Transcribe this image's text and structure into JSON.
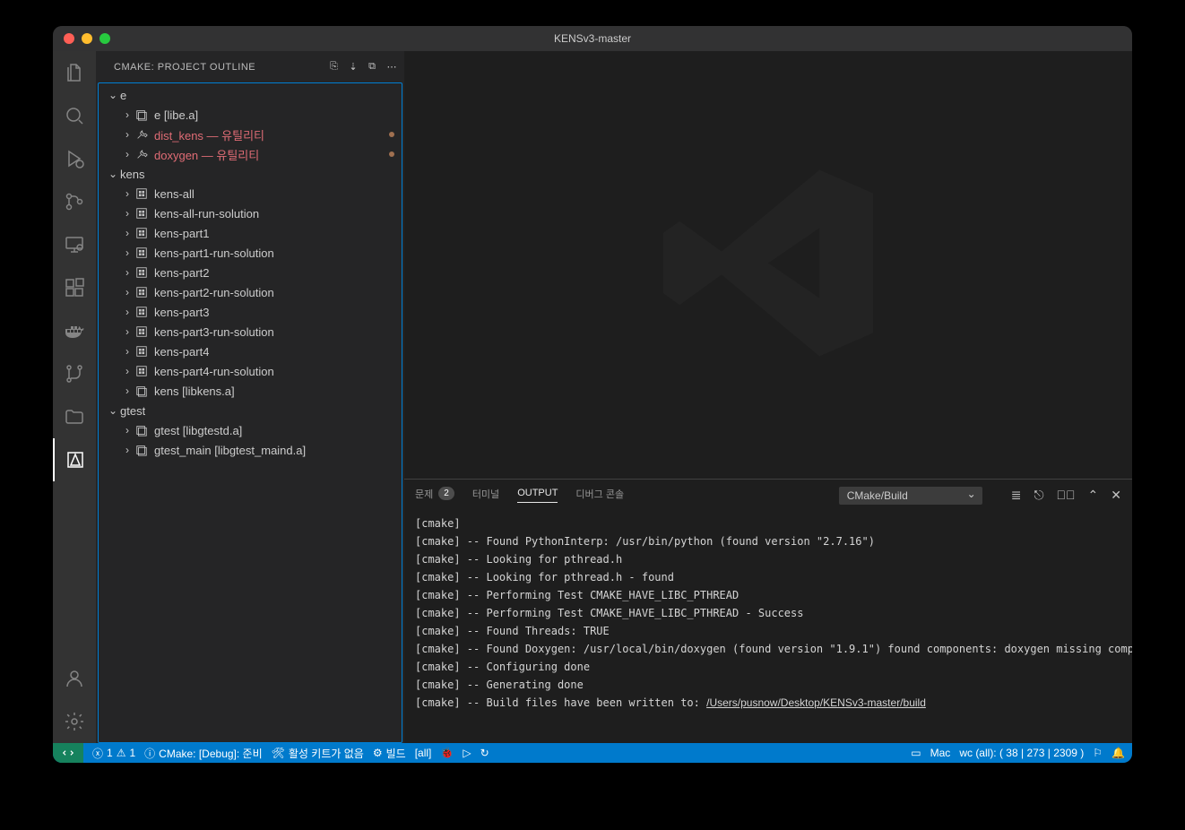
{
  "window": {
    "title": "KENSv3-master"
  },
  "sidebar": {
    "header": "CMAKE: PROJECT OUTLINE",
    "groups": [
      {
        "name": "e",
        "items": [
          {
            "label": "e [libe.a]",
            "icon": "lib",
            "err": false
          },
          {
            "label": "dist_kens — 유틸리티",
            "icon": "util",
            "err": true,
            "bullet": true
          },
          {
            "label": "doxygen — 유틸리티",
            "icon": "util",
            "err": true,
            "bullet": true
          }
        ]
      },
      {
        "name": "kens",
        "items": [
          {
            "label": "kens-all",
            "icon": "exe"
          },
          {
            "label": "kens-all-run-solution",
            "icon": "exe"
          },
          {
            "label": "kens-part1",
            "icon": "exe"
          },
          {
            "label": "kens-part1-run-solution",
            "icon": "exe"
          },
          {
            "label": "kens-part2",
            "icon": "exe"
          },
          {
            "label": "kens-part2-run-solution",
            "icon": "exe"
          },
          {
            "label": "kens-part3",
            "icon": "exe"
          },
          {
            "label": "kens-part3-run-solution",
            "icon": "exe"
          },
          {
            "label": "kens-part4",
            "icon": "exe"
          },
          {
            "label": "kens-part4-run-solution",
            "icon": "exe"
          },
          {
            "label": "kens [libkens.a]",
            "icon": "lib"
          }
        ]
      },
      {
        "name": "gtest",
        "items": [
          {
            "label": "gtest [libgtestd.a]",
            "icon": "lib"
          },
          {
            "label": "gtest_main [libgtest_maind.a]",
            "icon": "lib"
          }
        ]
      }
    ]
  },
  "panel": {
    "tabs": {
      "problems": "문제",
      "problems_count": "2",
      "terminal": "터미널",
      "output": "OUTPUT",
      "debug": "디버그 콘솔"
    },
    "selector": "CMake/Build",
    "output_lines": [
      "[cmake] ",
      "[cmake] -- Found PythonInterp: /usr/bin/python (found version \"2.7.16\")",
      "[cmake] -- Looking for pthread.h",
      "[cmake] -- Looking for pthread.h - found",
      "[cmake] -- Performing Test CMAKE_HAVE_LIBC_PTHREAD",
      "[cmake] -- Performing Test CMAKE_HAVE_LIBC_PTHREAD - Success",
      "[cmake] -- Found Threads: TRUE",
      "[cmake] -- Found Doxygen: /usr/local/bin/doxygen (found version \"1.9.1\") found components: doxygen missing compon",
      "[cmake] -- Configuring done",
      "[cmake] -- Generating done"
    ],
    "output_last_prefix": "[cmake] -- Build files have been written to: ",
    "output_last_link": "/Users/pusnow/Desktop/KENSv3-master/build"
  },
  "status": {
    "errors": "1",
    "warnings": "1",
    "cmake": "CMake: [Debug]: 준비",
    "kit": "활성 키트가 없음",
    "build": "빌드",
    "target": "[all]",
    "mac": "Mac",
    "wc": "wc (all): ( 38 | 273 | 2309 )"
  }
}
